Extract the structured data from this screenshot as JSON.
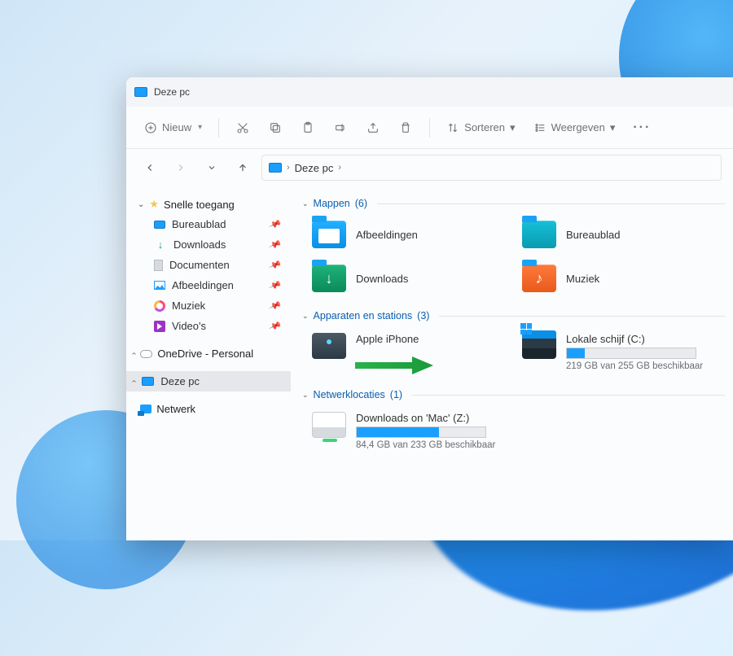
{
  "window": {
    "title": "Deze pc"
  },
  "toolbar": {
    "new": "Nieuw",
    "sort": "Sorteren",
    "view": "Weergeven"
  },
  "breadcrumb": {
    "item1": "Deze pc"
  },
  "sidebar": {
    "quick_access": "Snelle toegang",
    "items": [
      {
        "label": "Bureaublad"
      },
      {
        "label": "Downloads"
      },
      {
        "label": "Documenten"
      },
      {
        "label": "Afbeeldingen"
      },
      {
        "label": "Muziek"
      },
      {
        "label": "Video's"
      }
    ],
    "onedrive": "OneDrive - Personal",
    "this_pc": "Deze pc",
    "network": "Netwerk"
  },
  "sections": {
    "folders": {
      "title": "Mappen",
      "count": "(6)"
    },
    "devices": {
      "title": "Apparaten en stations",
      "count": "(3)"
    },
    "network": {
      "title": "Netwerklocaties",
      "count": "(1)"
    }
  },
  "folders": [
    {
      "label": "Afbeeldingen"
    },
    {
      "label": "Bureaublad"
    },
    {
      "label": "Downloads"
    },
    {
      "label": "Muziek"
    }
  ],
  "devices": {
    "iphone": {
      "label": "Apple iPhone"
    },
    "cdrive": {
      "label": "Lokale schijf (C:)",
      "sub": "219 GB van 255 GB beschikbaar",
      "fill_pct": 14
    }
  },
  "netloc": {
    "z": {
      "label": "Downloads on 'Mac' (Z:)",
      "sub": "84,4 GB van 233 GB beschikbaar",
      "fill_pct": 64
    }
  }
}
